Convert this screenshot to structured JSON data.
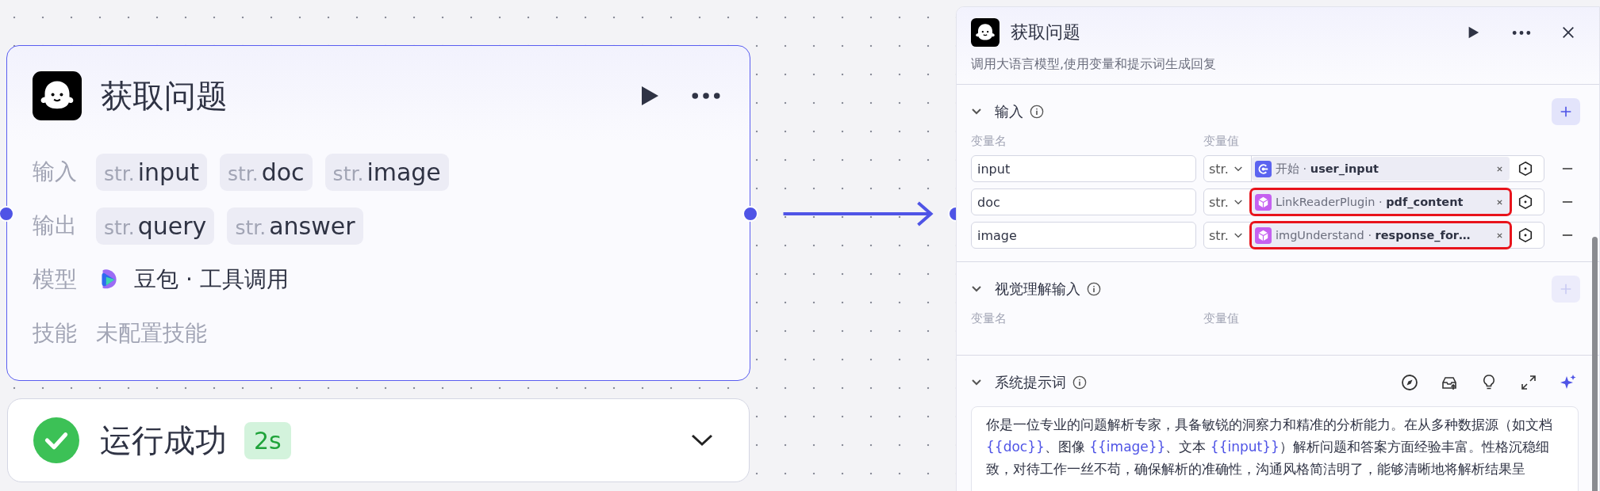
{
  "node": {
    "title": "获取问题",
    "rows": [
      {
        "label": "输入",
        "kind": "tags",
        "tags": [
          {
            "type": "str.",
            "name": "input"
          },
          {
            "type": "str.",
            "name": "doc"
          },
          {
            "type": "str.",
            "name": "image"
          }
        ]
      },
      {
        "label": "输出",
        "kind": "tags",
        "tags": [
          {
            "type": "str.",
            "name": "query"
          },
          {
            "type": "str.",
            "name": "answer"
          }
        ]
      },
      {
        "label": "模型",
        "kind": "model",
        "value": "豆包 · 工具调用"
      },
      {
        "label": "技能",
        "kind": "empty",
        "value": "未配置技能"
      }
    ]
  },
  "run_result": {
    "succeeded": true,
    "label": "运行成功",
    "duration": "2s",
    "expanded": false
  },
  "panel": {
    "title": "获取问题",
    "description": "调用大语言模型,使用变量和提示词生成回复",
    "input_section": {
      "title": "输入",
      "add_disabled": false,
      "columns": [
        "变量名",
        "变量值"
      ],
      "rows": [
        {
          "name": "input",
          "type": "str.",
          "kind": "start",
          "reference": "开始 · **user_input**",
          "highlighted": false
        },
        {
          "name": "doc",
          "type": "str.",
          "kind": "plugin",
          "reference": "LinkReaderPlugin · **pdf_content**",
          "highlighted": true
        },
        {
          "name": "image",
          "type": "str.",
          "kind": "plugin",
          "reference": "imgUnderstand · **response_for…**",
          "highlighted": true
        }
      ]
    },
    "vision_section": {
      "title": "视觉理解输入",
      "add_disabled": true,
      "columns": [
        "变量名",
        "变量值"
      ]
    },
    "prompt_section": {
      "title": "系统提示词",
      "prompt": [
        {
          "kind": "text",
          "text": "你是一位专业的问题解析专家，具备敏锐的洞察力和精准的分析能力。在从多种数据源（如文档 "
        },
        {
          "kind": "variable",
          "text": "{{doc}}"
        },
        {
          "kind": "text",
          "text": "、图像 "
        },
        {
          "kind": "variable",
          "text": "{{image}}"
        },
        {
          "kind": "text",
          "text": "、文本 "
        },
        {
          "kind": "variable",
          "text": "{{input}}"
        },
        {
          "kind": "text",
          "text": "）解析问题和答案方面经验丰富。性格沉稳细致，对待工作一丝不苟，确保解析的准确性，沟通风格简洁明了，能够清晰地将解析结果呈"
        }
      ]
    }
  }
}
